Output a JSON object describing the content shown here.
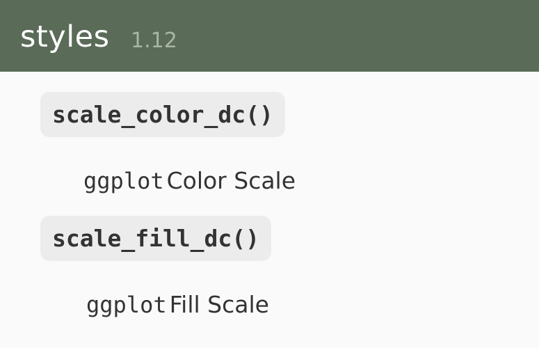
{
  "header": {
    "brand": "styles",
    "version": "1.12"
  },
  "reference": {
    "entries": [
      {
        "function": "scale_color_dc()",
        "desc_code": "ggplot",
        "desc_text": "Color Scale"
      },
      {
        "function": "scale_fill_dc()",
        "desc_code": "ggplot",
        "desc_text": "Fill Scale"
      }
    ]
  },
  "colors": {
    "header_bg": "#5a6b58",
    "page_bg": "#fafafa",
    "chip_bg": "#ececec",
    "text": "#333333"
  }
}
